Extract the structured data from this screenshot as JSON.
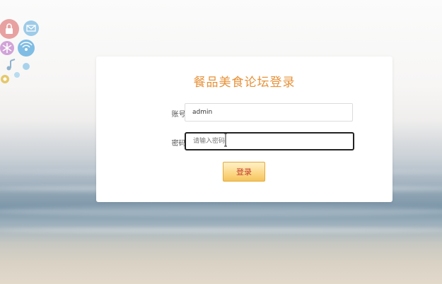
{
  "logo": {
    "icons": [
      "lock-icon",
      "mail-icon",
      "asterisk-icon",
      "wifi-icon",
      "music-note-icon",
      "dot-icon",
      "circle-icon"
    ]
  },
  "login": {
    "title": "餐品美食论坛登录",
    "username_label": "账号:",
    "username_value": "admin",
    "password_label": "密码:",
    "password_placeholder": "请输入密码",
    "submit_label": "登录"
  },
  "colors": {
    "title": "#e6923a",
    "button_text": "#c0392b",
    "button_border": "#e2ab3b"
  }
}
